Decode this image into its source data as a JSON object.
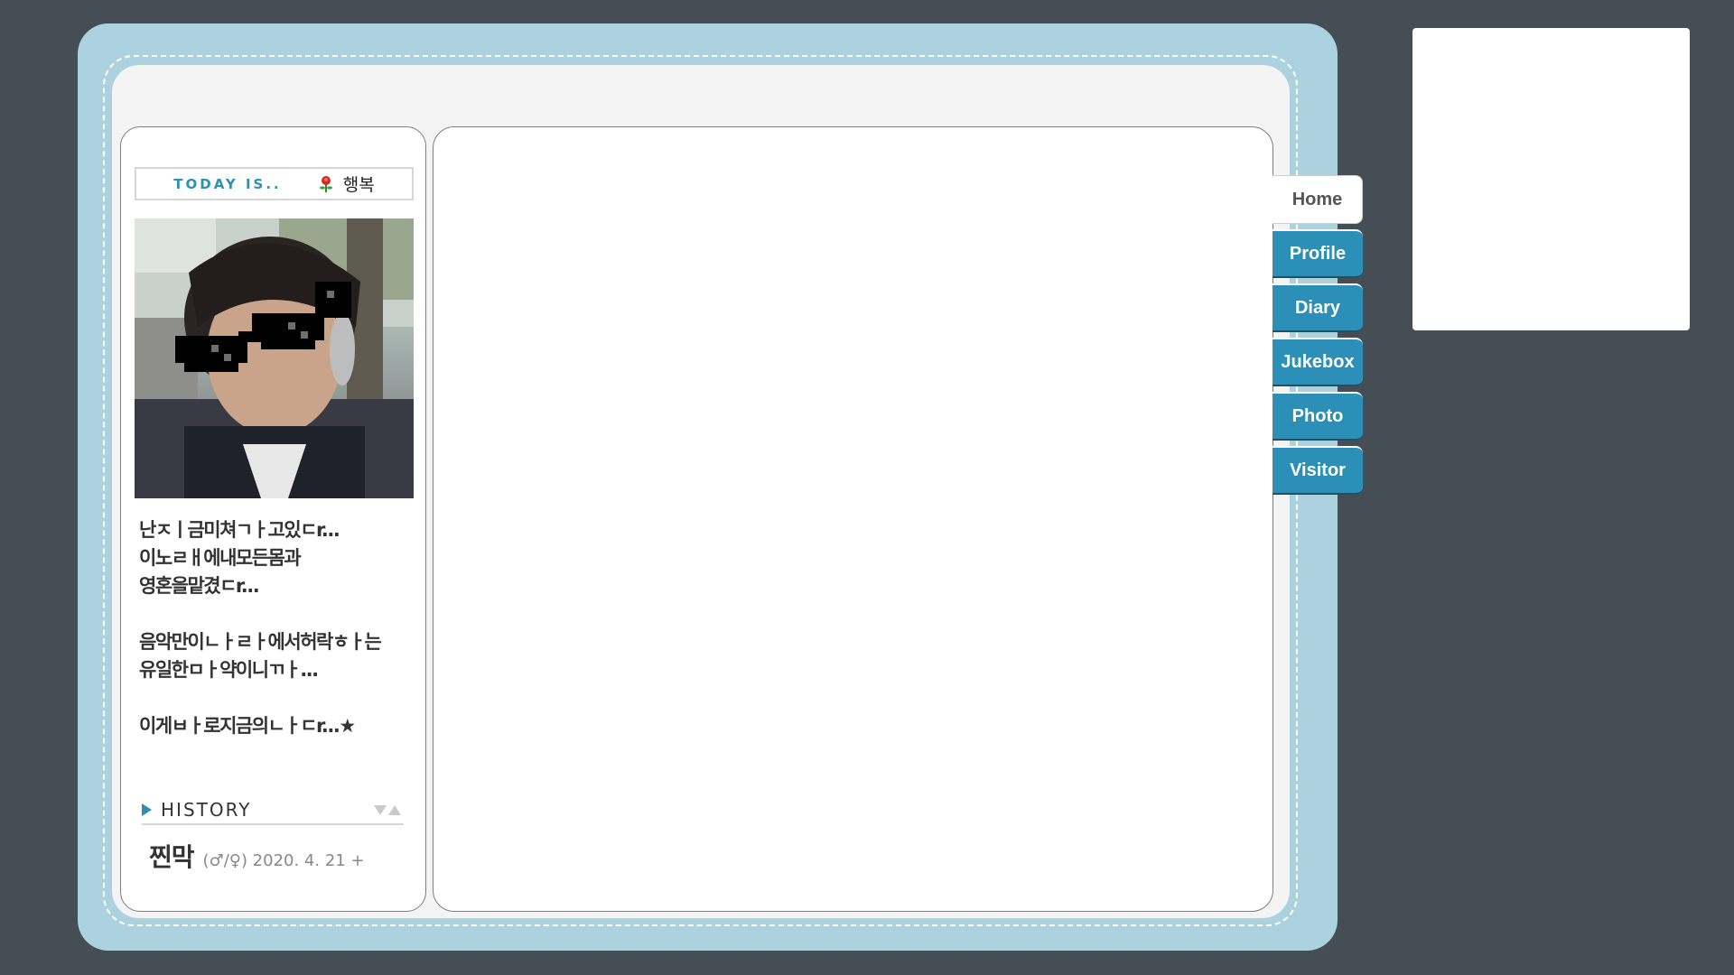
{
  "today": {
    "label": "TODAY IS..",
    "mood_icon": "flower-icon",
    "mood": "행복"
  },
  "profile": {
    "photo": "profile-photo-with-pixel-sunglasses",
    "intro": [
      "난ㅈㅣ금미쳐ㄱㅏ고있ㄷr...\n이노ㄹㅐ에내모든몸과\n영혼을맡겼ㄷr...",
      "음악만이ㄴㅏㄹㅏ에서허락ㅎㅏ는\n유일한ㅁㅏ약이니ㄲㅏ...",
      "이게ㅂㅏ로지금의ㄴㅏㄷr...★"
    ]
  },
  "history": {
    "label": "HISTORY",
    "entry_name": "찐막",
    "entry_meta": "(♂/♀) 2020. 4. 21 +"
  },
  "tabs": [
    {
      "label": "Home",
      "active": true
    },
    {
      "label": "Profile",
      "active": false
    },
    {
      "label": "Diary",
      "active": false
    },
    {
      "label": "Jukebox",
      "active": false
    },
    {
      "label": "Photo",
      "active": false
    },
    {
      "label": "Visitor",
      "active": false
    }
  ],
  "colors": {
    "background": "#454d55",
    "frame": "#abd2de",
    "accent": "#2b8fb8"
  }
}
